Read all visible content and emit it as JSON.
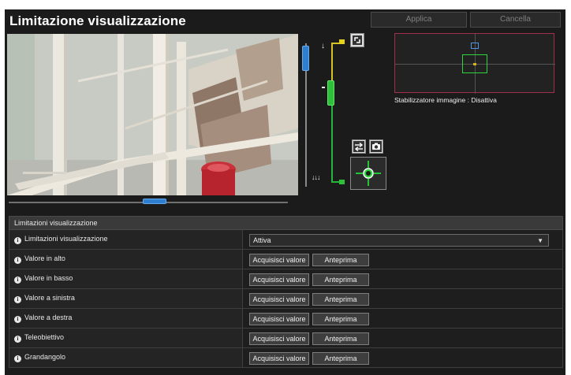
{
  "header": {
    "title": "Limitazione visualizzazione",
    "apply_label": "Applica",
    "cancel_label": "Cancella"
  },
  "overview": {
    "stabilizer_text": "Stabilizzatore immagine : Disattiva"
  },
  "colors": {
    "zoom_thumb": "#2f7fd0",
    "tele_limit": "#d4c322",
    "wide_limit": "#27b43a",
    "overview_border": "#a0304a"
  },
  "icons": [
    "expand-icon",
    "swap-icon",
    "camera-icon",
    "center-target-icon",
    "tele-icon",
    "wide-icon",
    "info-icon",
    "dropdown-arrow-icon"
  ],
  "section": {
    "header": "Limitazioni visualizzazione",
    "rows": [
      {
        "label": "Limitazioni visualizzazione",
        "type": "select",
        "value": "Attiva"
      },
      {
        "label": "Valore in alto",
        "type": "buttons",
        "acquire": "Acquisisci valore",
        "preview": "Anteprima"
      },
      {
        "label": "Valore in basso",
        "type": "buttons",
        "acquire": "Acquisisci valore",
        "preview": "Anteprima"
      },
      {
        "label": "Valore a sinistra",
        "type": "buttons",
        "acquire": "Acquisisci valore",
        "preview": "Anteprima"
      },
      {
        "label": "Valore a destra",
        "type": "buttons",
        "acquire": "Acquisisci valore",
        "preview": "Anteprima"
      },
      {
        "label": "Teleobiettivo",
        "type": "buttons",
        "acquire": "Acquisisci valore",
        "preview": "Anteprima"
      },
      {
        "label": "Grandangolo",
        "type": "buttons",
        "acquire": "Acquisisci valore",
        "preview": "Anteprima"
      }
    ]
  }
}
